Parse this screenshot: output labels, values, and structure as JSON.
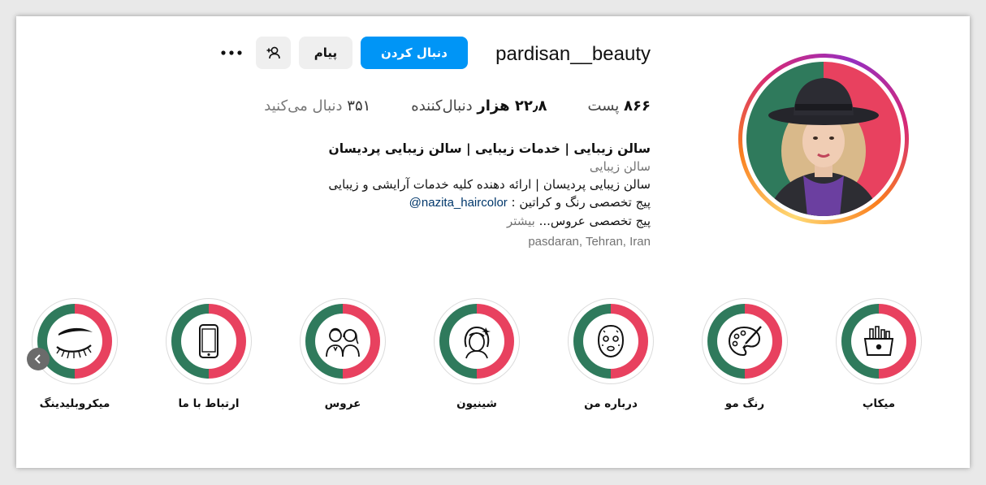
{
  "profile": {
    "username": "pardisan__beauty",
    "follow_label": "دنبال کردن",
    "message_label": "پیام",
    "stats": {
      "posts_value": "۸۶۶",
      "posts_label": "پست",
      "followers_value": "۲۲٫۸ هزار",
      "followers_label": "دنبال‌کننده",
      "following_value": "۳۵۱",
      "following_label": "دنبال می‌کنید"
    },
    "bio": {
      "name": "سالن زیبایی | خدمات زیبایی | سالن زیبایی پردیسان",
      "category": "سالن زیبایی",
      "line1": "سالن زیبایی پردیسان | ارائه دهنده کلیه خدمات آرایشی و زیبایی",
      "line2_text": "پیج تخصصی رنگ و کراتین : ",
      "line2_link": "@nazita_haircolor",
      "line3_text": "پیج تخصصی عروس...",
      "line3_more": " بیشتر",
      "location": "pasdaran, Tehran, Iran"
    }
  },
  "highlights": [
    {
      "label": "میکاپ",
      "icon": "makeup-bag-icon"
    },
    {
      "label": "رنگ مو",
      "icon": "palette-brush-icon"
    },
    {
      "label": "درباره من",
      "icon": "face-mask-icon"
    },
    {
      "label": "شینیون",
      "icon": "hairstyle-icon"
    },
    {
      "label": "عروس",
      "icon": "couple-icon"
    },
    {
      "label": "ارتباط با ما",
      "icon": "phone-icon"
    },
    {
      "label": "میکروبلیدینگ",
      "icon": "eyebrow-lash-icon"
    }
  ],
  "colors": {
    "follow_button": "#0095f6",
    "highlight_green": "#2f7a5c",
    "highlight_pink": "#e8415f"
  }
}
